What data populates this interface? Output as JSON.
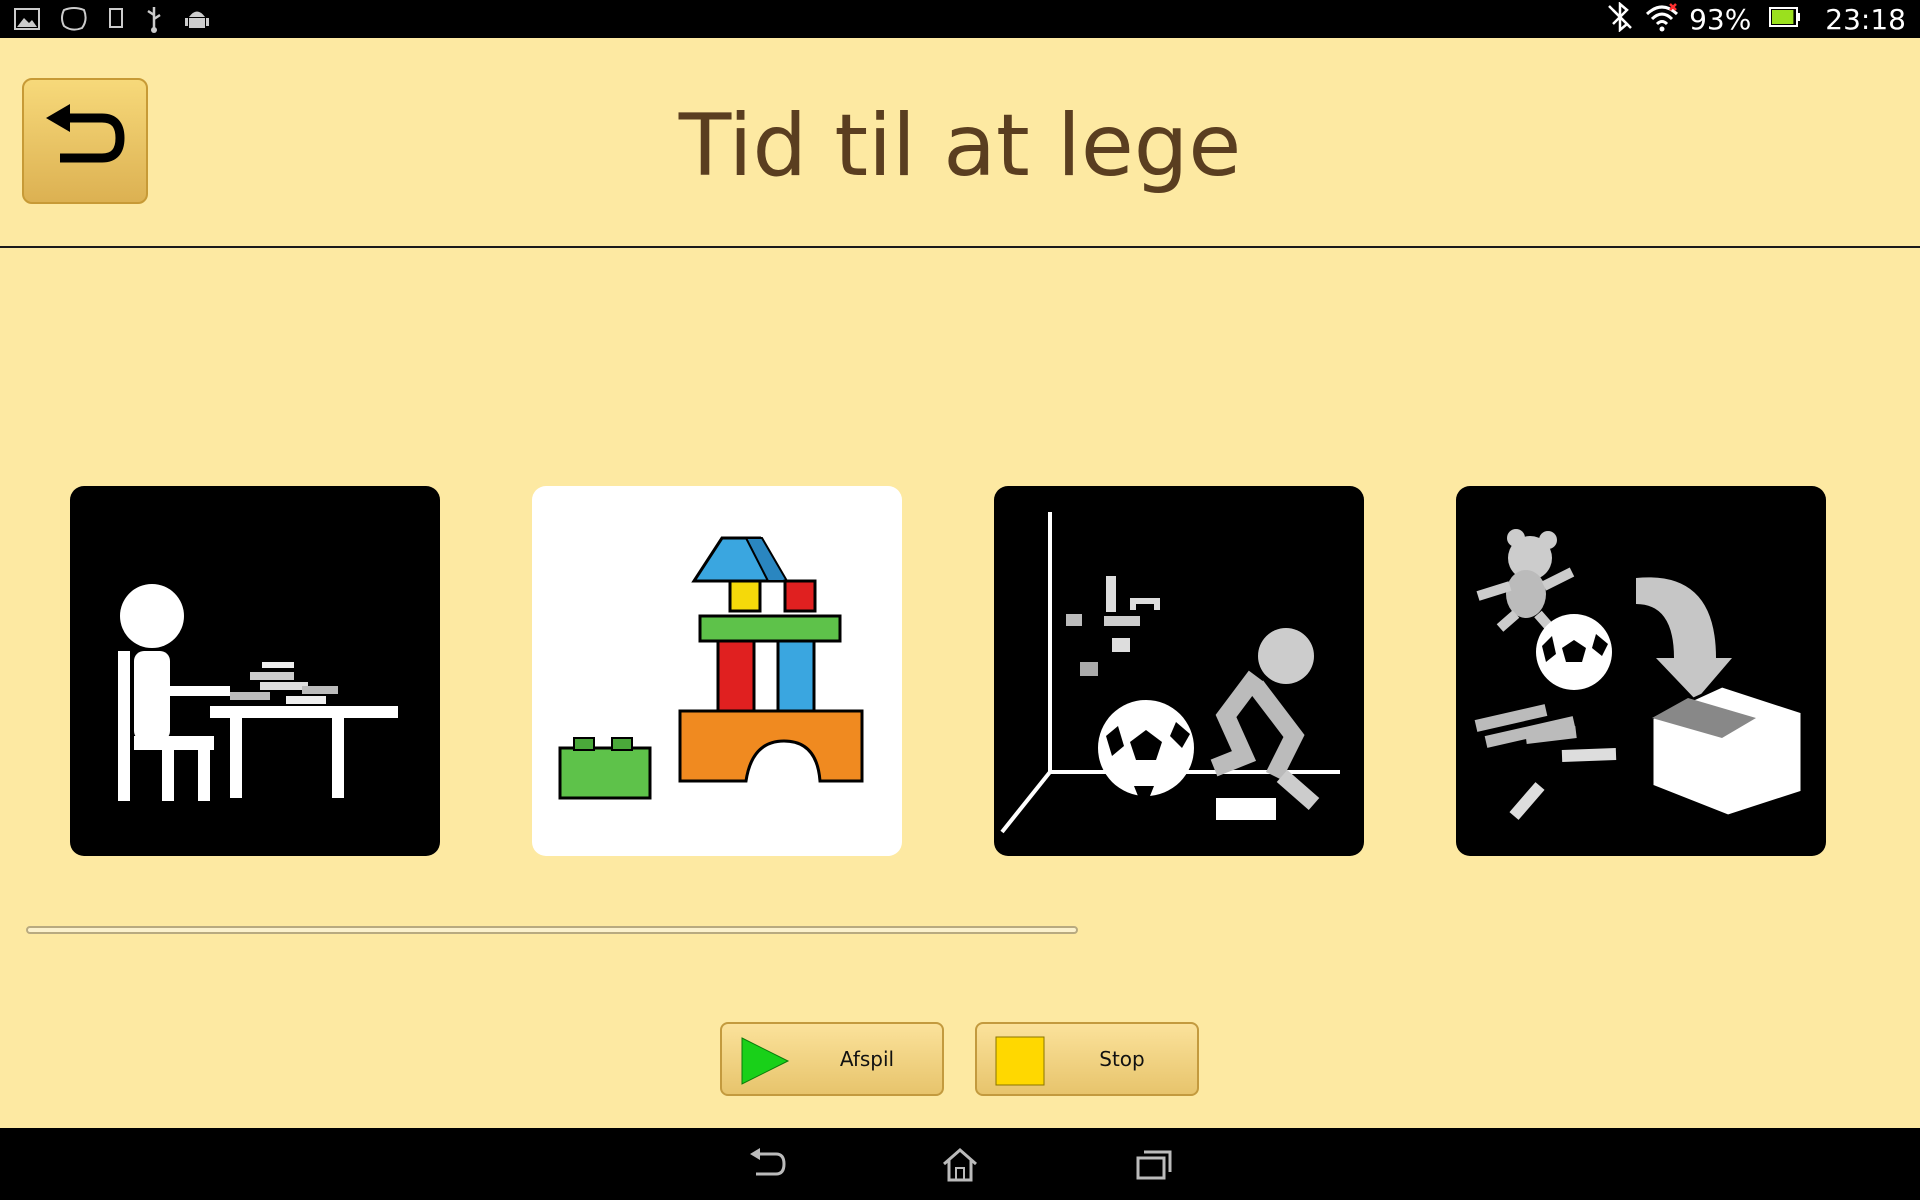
{
  "status_bar": {
    "left_icons": [
      "gallery-icon",
      "app-blob-icon",
      "phone-icon",
      "usb-icon",
      "android-icon"
    ],
    "right_icons": [
      "bluetooth-off-icon",
      "wifi-icon",
      "battery-icon"
    ],
    "battery_text": "93%",
    "battery_level": 0.93,
    "time": "23:18"
  },
  "header": {
    "back_icon": "back-arrow-icon",
    "title": "Tid til at lege"
  },
  "pictograms": [
    {
      "name": "desk-activity",
      "background": "#000000",
      "highlighted": false
    },
    {
      "name": "building-blocks",
      "background": "#ffffff",
      "highlighted": true
    },
    {
      "name": "playing-with-toys",
      "background": "#000000",
      "highlighted": false
    },
    {
      "name": "tidy-up-toys",
      "background": "#000000",
      "highlighted": false
    }
  ],
  "progress": {
    "fraction": 0.0
  },
  "controls": {
    "play_label": "Afspil",
    "play_icon": "play-triangle-icon",
    "play_color": "#19d019",
    "stop_label": "Stop",
    "stop_icon": "stop-square-icon",
    "stop_color": "#ffd800"
  },
  "nav_bar": {
    "icons": [
      "nav-back-icon",
      "nav-home-icon",
      "nav-recents-icon"
    ]
  },
  "colors": {
    "background": "#fde9a2",
    "title": "#5a3e20",
    "button_gradient_top": "#f7d97a",
    "button_gradient_bottom": "#dcb152"
  }
}
